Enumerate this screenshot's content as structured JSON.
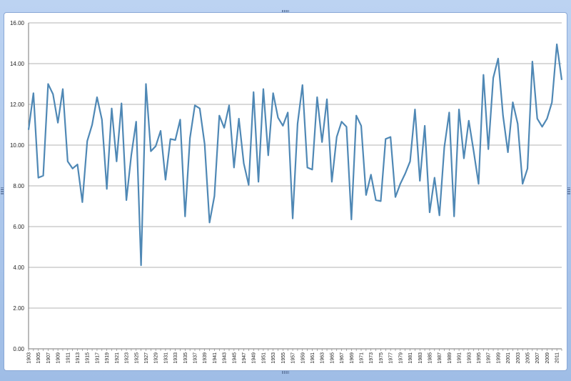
{
  "chart_data": {
    "type": "line",
    "title": "",
    "xlabel": "",
    "ylabel": "",
    "ylim": [
      0,
      16
    ],
    "yticks": [
      "0.00",
      "2.00",
      "4.00",
      "6.00",
      "8.00",
      "10.00",
      "12.00",
      "14.00",
      "16.00"
    ],
    "grid": true,
    "legend": "none",
    "line_color": "#4f88b5",
    "grid_color": "#9a9a9a",
    "x": [
      1903,
      1904,
      1905,
      1906,
      1907,
      1908,
      1909,
      1910,
      1911,
      1912,
      1913,
      1914,
      1915,
      1916,
      1917,
      1918,
      1919,
      1920,
      1921,
      1922,
      1923,
      1924,
      1925,
      1926,
      1927,
      1928,
      1929,
      1930,
      1931,
      1932,
      1933,
      1934,
      1935,
      1936,
      1937,
      1938,
      1939,
      1940,
      1941,
      1942,
      1943,
      1944,
      1945,
      1946,
      1947,
      1948,
      1949,
      1950,
      1951,
      1952,
      1953,
      1954,
      1955,
      1956,
      1957,
      1958,
      1959,
      1960,
      1961,
      1962,
      1963,
      1964,
      1965,
      1966,
      1967,
      1968,
      1969,
      1970,
      1971,
      1972,
      1973,
      1974,
      1975,
      1976,
      1977,
      1978,
      1979,
      1980,
      1981,
      1982,
      1983,
      1984,
      1985,
      1986,
      1987,
      1988,
      1989,
      1990,
      1991,
      1992,
      1993,
      1994,
      1995,
      1996,
      1997,
      1998,
      1999,
      2000,
      2001,
      2002,
      2003,
      2004,
      2005,
      2006,
      2007,
      2008,
      2009,
      2010,
      2011,
      2012
    ],
    "x_tick_labels": [
      "1903",
      "1905",
      "1907",
      "1909",
      "1911",
      "1913",
      "1915",
      "1917",
      "1919",
      "1921",
      "1923",
      "1925",
      "1927",
      "1929",
      "1931",
      "1933",
      "1935",
      "1937",
      "1939",
      "1941",
      "1943",
      "1945",
      "1947",
      "1949",
      "1951",
      "1953",
      "1955",
      "1957",
      "1959",
      "1961",
      "1963",
      "1965",
      "1967",
      "1969",
      "1971",
      "1973",
      "1975",
      "1977",
      "1979",
      "1981",
      "1983",
      "1985",
      "1987",
      "1989",
      "1991",
      "1993",
      "1995",
      "1997",
      "1999",
      "2001",
      "2003",
      "2005",
      "2007",
      "2009",
      "2011"
    ],
    "series": [
      {
        "values": [
          10.75,
          12.55,
          8.4,
          8.5,
          13.0,
          12.5,
          11.1,
          12.75,
          9.2,
          8.85,
          9.05,
          7.2,
          10.2,
          11.0,
          12.35,
          11.25,
          7.85,
          11.8,
          9.2,
          12.05,
          7.3,
          9.5,
          11.15,
          4.1,
          13.0,
          9.7,
          9.95,
          10.7,
          8.3,
          10.3,
          10.25,
          11.25,
          6.5,
          10.35,
          11.95,
          11.8,
          10.05,
          6.2,
          7.5,
          11.45,
          10.85,
          11.95,
          8.9,
          11.3,
          9.1,
          8.05,
          12.6,
          8.2,
          12.75,
          9.5,
          12.55,
          11.35,
          10.95,
          11.6,
          6.4,
          11.05,
          12.95,
          8.9,
          8.8,
          12.35,
          10.15,
          12.25,
          8.2,
          10.4,
          11.15,
          10.9,
          6.35,
          11.45,
          10.95,
          7.55,
          8.55,
          7.3,
          7.25,
          10.3,
          10.4,
          7.45,
          8.1,
          8.6,
          9.2,
          11.75,
          8.25,
          10.95,
          6.7,
          8.4,
          6.55,
          9.9,
          11.6,
          6.5,
          11.75,
          9.35,
          11.2,
          9.7,
          8.1,
          13.45,
          9.8,
          13.3,
          14.25,
          11.45,
          9.65,
          12.1,
          11.05,
          8.1,
          8.85,
          14.1,
          11.3,
          10.9,
          11.3,
          12.1,
          14.95,
          13.2
        ]
      }
    ]
  }
}
